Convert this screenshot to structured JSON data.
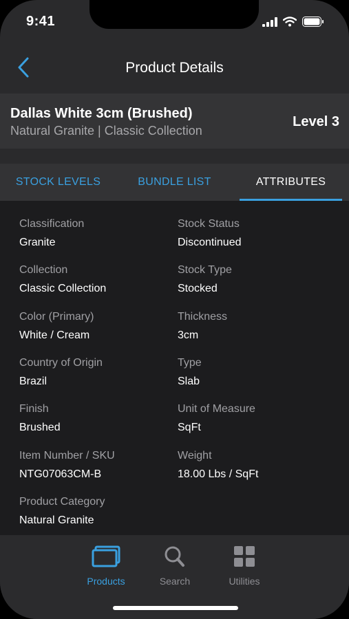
{
  "status": {
    "time": "9:41"
  },
  "nav": {
    "title": "Product Details"
  },
  "product": {
    "name": "Dallas White 3cm (Brushed)",
    "subtitle": "Natural Granite | Classic Collection",
    "level": "Level 3"
  },
  "tabs": [
    "STOCK LEVELS",
    "BUNDLE LIST",
    "ATTRIBUTES"
  ],
  "attributes": [
    {
      "label": "Classification",
      "value": "Granite"
    },
    {
      "label": "Stock Status",
      "value": "Discontinued"
    },
    {
      "label": "Collection",
      "value": "Classic Collection"
    },
    {
      "label": "Stock Type",
      "value": "Stocked"
    },
    {
      "label": "Color (Primary)",
      "value": "White / Cream"
    },
    {
      "label": "Thickness",
      "value": "3cm"
    },
    {
      "label": "Country of Origin",
      "value": "Brazil"
    },
    {
      "label": "Type",
      "value": "Slab"
    },
    {
      "label": "Finish",
      "value": "Brushed"
    },
    {
      "label": "Unit of Measure",
      "value": "SqFt"
    },
    {
      "label": "Item Number / SKU",
      "value": "NTG07063CM-B"
    },
    {
      "label": "Weight",
      "value": "18.00 Lbs / SqFt"
    },
    {
      "label": "Product Category",
      "value": "Natural Granite"
    }
  ],
  "tabbar": [
    {
      "label": "Products",
      "icon": "products-icon",
      "active": true
    },
    {
      "label": "Search",
      "icon": "search-icon",
      "active": false
    },
    {
      "label": "Utilities",
      "icon": "grid-icon",
      "active": false
    }
  ],
  "colors": {
    "accent": "#3aa0e0",
    "background": "#1c1c1e",
    "header": "#343436"
  }
}
